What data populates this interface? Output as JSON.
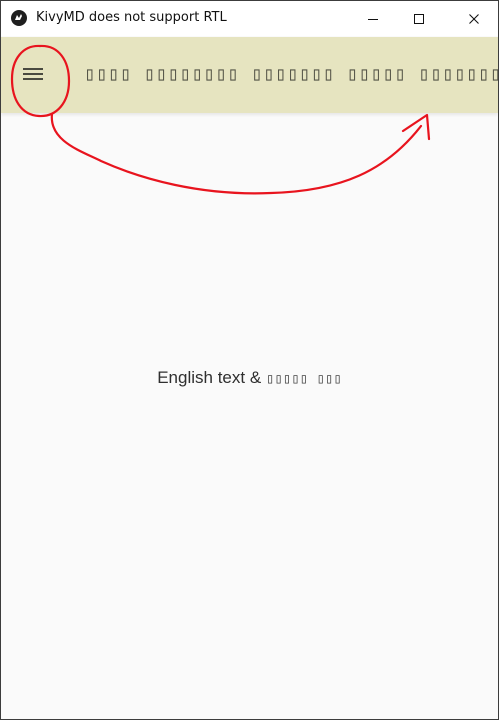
{
  "window": {
    "title": "KivyMD does not support RTL"
  },
  "toolbar": {
    "title": "▯▯▯▯ ▯▯▯▯▯▯▯▯ ▯▯▯▯▯▯▯ ▯▯▯▯▯ ▯▯▯▯▯▯▯",
    "menu_icon": "hamburger-menu-icon",
    "background": "#e6e4c0"
  },
  "content": {
    "english_text": "English text &",
    "arabic_text": "▯▯▯▯▯ ▯▯▯"
  },
  "annotation": {
    "color": "#e8141e"
  }
}
